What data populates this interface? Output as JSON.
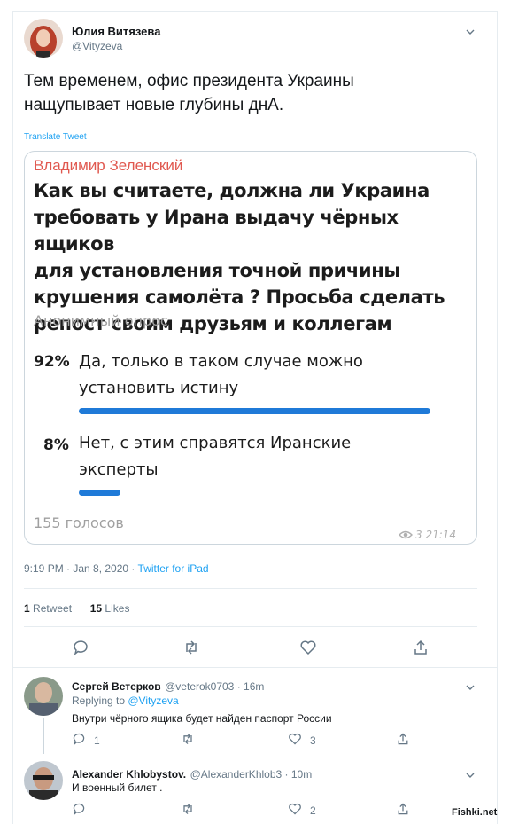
{
  "main_tweet": {
    "author_name": "Юлия Витязева",
    "author_handle": "@Vityzeva",
    "text_line1": "Тем временем, офис президента Украины",
    "text_line2": "нащупывает новые глубины днА.",
    "translate_label": "Translate Tweet",
    "timestamp": "9:19 PM · Jan 8, 2020 · ",
    "source": "Twitter for iPad",
    "retweets_count": "1",
    "retweets_label": " Retweet",
    "likes_count": "15",
    "likes_label": " Likes"
  },
  "quoted_poll": {
    "author": "Владимир Зеленский",
    "question_lines": [
      "Как вы считаете, должна ли Украина",
      "требовать у Ирана выдачу чёрных ящиков",
      "для установления точной причины",
      "крушения самолёта ? Просьба сделать",
      "репост своим друзьям и коллегам"
    ],
    "poll_type": "Анонимный опрос",
    "options": [
      {
        "percent": "92%",
        "percent_value": 92,
        "line1": "Да, только в таком случае можно",
        "line2": "установить истину"
      },
      {
        "percent": "8%",
        "percent_value": 8,
        "line1": "Нет, с этим справятся Иранские",
        "line2": "эксперты"
      }
    ],
    "votes": "155 голосов",
    "views": "3 21:14",
    "bar_color": "#1f7ad8"
  },
  "replies": [
    {
      "name": "Сергей Ветерков",
      "handle": "@veterok0703 · 16m",
      "replying_label": "Replying to ",
      "replying_to": "@Vityzeva",
      "text": "Внутри чёрного ящика будет найден паспорт России",
      "reply_count": "1",
      "retweet_count": "",
      "like_count": "3"
    },
    {
      "name": "Alexander Khlobystov.",
      "handle": "@AlexanderKhlob3 · 10m",
      "text": "И военный билет .",
      "reply_count": "",
      "retweet_count": "",
      "like_count": "2"
    }
  ],
  "watermark": "Fishki.net",
  "colors": {
    "link": "#1da1f2",
    "poll_author": "#e0584f",
    "border": "#e6ecf0"
  }
}
